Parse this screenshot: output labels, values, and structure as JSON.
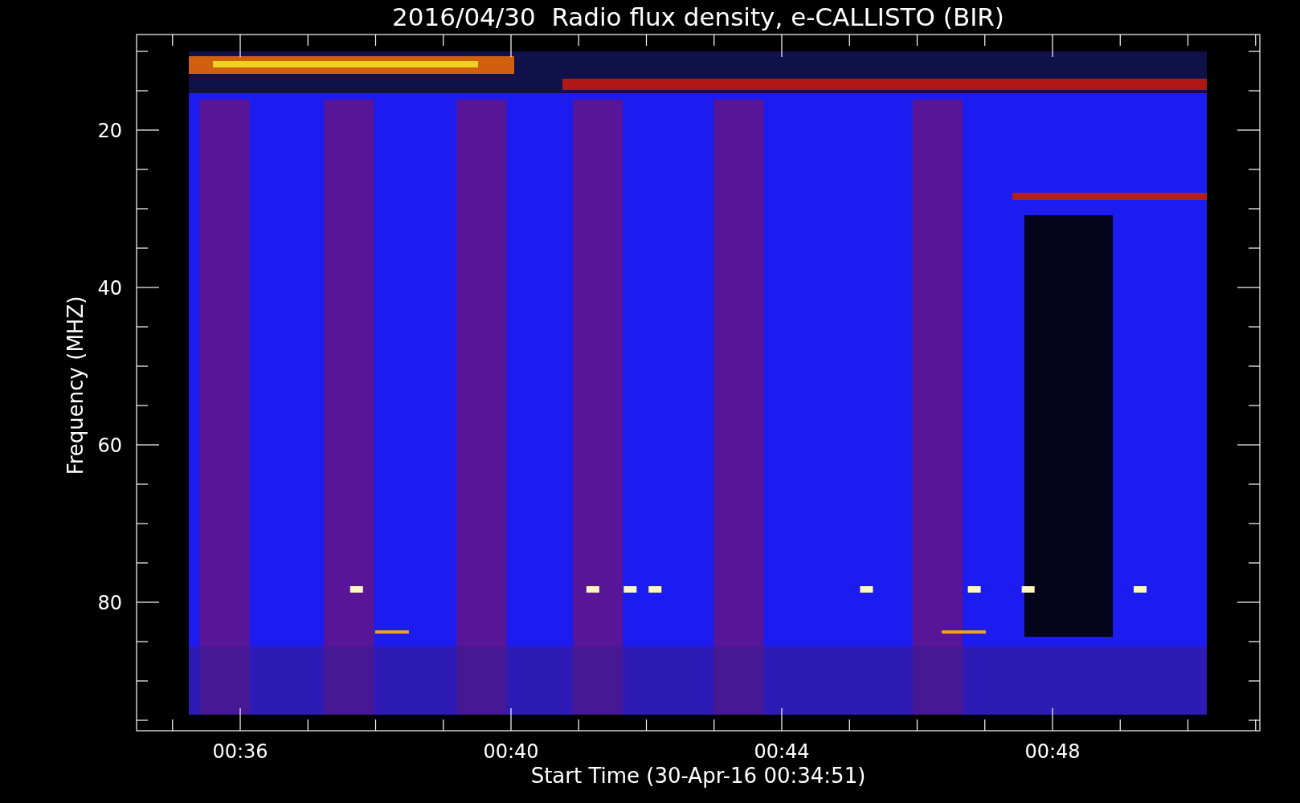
{
  "plot": {
    "title": "2016/04/30  Radio flux density, e-CALLISTO (BIR)",
    "xlabel": "Start Time (30-Apr-16 00:34:51)",
    "ylabel": "Frequency (MHZ)",
    "xtick_labels": [
      "00:36",
      "00:40",
      "00:44",
      "00:48"
    ],
    "ytick_labels": [
      "20",
      "40",
      "60",
      "80"
    ]
  }
}
